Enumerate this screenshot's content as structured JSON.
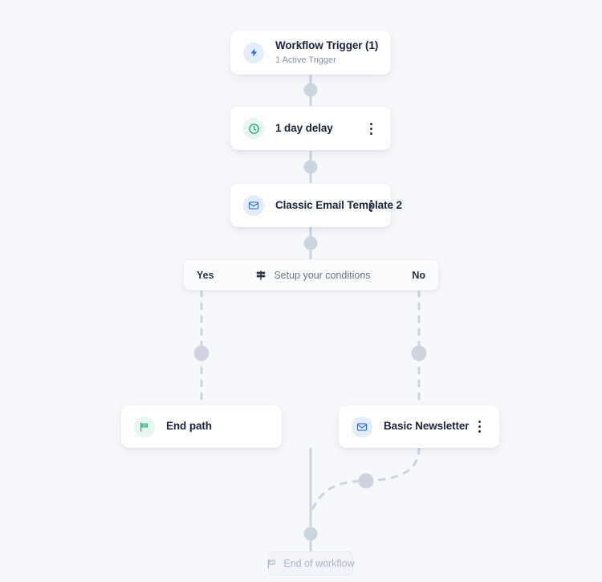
{
  "canvas": {
    "background_color": "#f7f8fc",
    "edge_color": "#ccd4e0",
    "card_color": "#ffffff"
  },
  "nodes": [
    {
      "id": "workflow-trigger",
      "title": "Workflow Trigger (1)",
      "subtitle": "1 Active Trigger",
      "icon": "lightning-bolt-icon",
      "icon_color": "#2b6df6",
      "icon_bg": "#e4edfe",
      "has_menu": false
    },
    {
      "id": "delay",
      "title": "1 day delay",
      "icon": "clock-icon",
      "icon_color": "#16a46b",
      "icon_bg": "#e6f7f0",
      "has_menu": true
    },
    {
      "id": "classic-email-template",
      "title": "Classic Email Template 2",
      "icon": "envelope-icon",
      "icon_color": "#2b6df6",
      "icon_bg": "#e4edfe",
      "has_menu": true
    },
    {
      "id": "end-path",
      "title": "End path",
      "icon": "flag-icon",
      "icon_color": "#29b47e",
      "icon_bg": "#e6f7f0",
      "has_menu": false
    },
    {
      "id": "basic-newsletter",
      "title": "Basic Newsletter",
      "icon": "envelope-icon",
      "icon_color": "#2b6df6",
      "icon_bg": "#e4edfe",
      "has_menu": true
    }
  ],
  "condition_bar": {
    "yes_label": "Yes",
    "no_label": "No",
    "center_label": "Setup your conditions",
    "icon": "signpost-icon",
    "icon_color": "#2a3047"
  },
  "end_of_workflow": {
    "label": "End of workflow",
    "icon": "flag-icon",
    "icon_color": "#aeb5c6"
  },
  "menu": {
    "icon": "kebab-menu-icon"
  }
}
